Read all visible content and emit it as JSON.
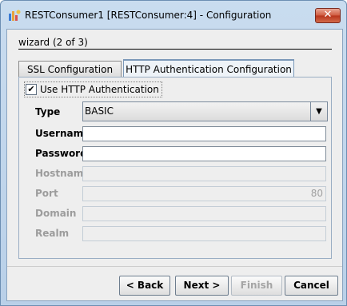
{
  "window": {
    "title": "RESTConsumer1 [RESTConsumer:4] - Configuration",
    "close_glyph": "✕"
  },
  "wizard": {
    "step_label": "wizard (2 of 3)"
  },
  "tabs": [
    {
      "label": "SSL Configuration"
    },
    {
      "label": "HTTP Authentication Configuration"
    }
  ],
  "form": {
    "use_auth": {
      "label": "Use HTTP Authentication",
      "checked": true,
      "glyph": "✔"
    },
    "type": {
      "label": "Type",
      "value": "BASIC",
      "arrow": "▼"
    },
    "username": {
      "label": "Username",
      "value": ""
    },
    "password": {
      "label": "Password",
      "value": ""
    },
    "hostname": {
      "label": "Hostname",
      "value": ""
    },
    "port": {
      "label": "Port",
      "value": "80"
    },
    "domain": {
      "label": "Domain",
      "value": ""
    },
    "realm": {
      "label": "Realm",
      "value": ""
    }
  },
  "buttons": {
    "back": "< Back",
    "next": "Next >",
    "finish": "Finish",
    "cancel": "Cancel"
  }
}
